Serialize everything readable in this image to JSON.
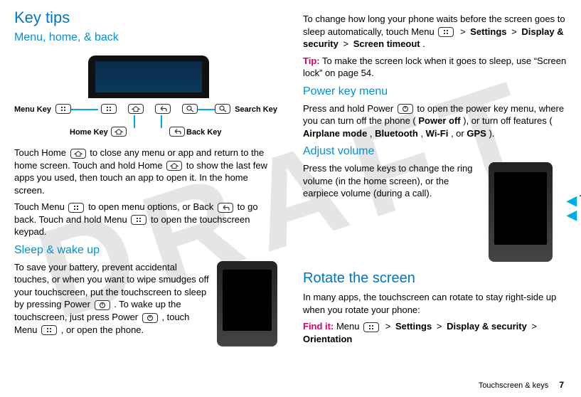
{
  "watermark": "DRAFT",
  "left": {
    "h1": "Key tips",
    "sub1": "Menu, home, & back",
    "diagram": {
      "menu_key": "Menu Key",
      "home_key": "Home Key",
      "back_key": "Back Key",
      "search_key": "Search Key"
    },
    "p1a": "Touch Home ",
    "p1b": " to close any menu or app and return to the home screen. Touch and hold Home ",
    "p1c": " to show the last few apps you used, then touch an app to open it. In the home screen.",
    "p2a": "Touch Menu ",
    "p2b": " to open menu options, or Back ",
    "p2c": " to go back. Touch and hold Menu ",
    "p2d": " to open the touchscreen keypad.",
    "sub2": "Sleep & wake up",
    "p3a": "To save your battery, prevent accidental touches, or when you want to wipe smudges off your touchscreen, put the touchscreen to sleep by pressing Power ",
    "p3b": ". To wake up the touchscreen, just press Power ",
    "p3c": ", touch Menu ",
    "p3d": ", or open the phone."
  },
  "right": {
    "p1a": "To change how long your phone waits before the screen goes to sleep automatically, touch Menu ",
    "p1b_sep1": " > ",
    "p1b_settings": "Settings",
    "p1b_sep2": " > ",
    "p1b_display": "Display & security",
    "p1b_sep3": " > ",
    "p1b_timeout": "Screen timeout",
    "p1b_period": ".",
    "tip_label": "Tip:",
    "tip_text": " To make the screen lock when it goes to sleep, use “Screen lock” on page 54.",
    "sub_power": "Power key menu",
    "p_power_a": "Press and hold Power ",
    "p_power_b": " to open the power key menu, where you can turn off the phone (",
    "p_power_off": "Power off",
    "p_power_c": "), or turn off features (",
    "p_air": "Airplane mode",
    "p_comma1": ", ",
    "p_bt": "Bluetooth",
    "p_comma2": ", ",
    "p_wifi": "Wi-Fi",
    "p_comma3": ", or ",
    "p_gps": "GPS",
    "p_power_end": ").",
    "sub_vol": "Adjust volume",
    "p_vol": "Press the volume keys to change the ring volume (in the home screen), or the earpiece volume (during a call).",
    "plus": "+",
    "minus": "-",
    "h_rotate": "Rotate the screen",
    "p_rotate": "In many apps, the touchscreen can rotate to stay right-side up when you rotate your phone:",
    "findit_label": "Find it:",
    "findit_a": " Menu ",
    "findit_sep1": " > ",
    "findit_settings": "Settings",
    "findit_sep2": " > ",
    "findit_display": "Display & security",
    "findit_sep3": " > ",
    "findit_orientation": "Orientation"
  },
  "footer": {
    "section": "Touchscreen & keys",
    "page": "7"
  }
}
